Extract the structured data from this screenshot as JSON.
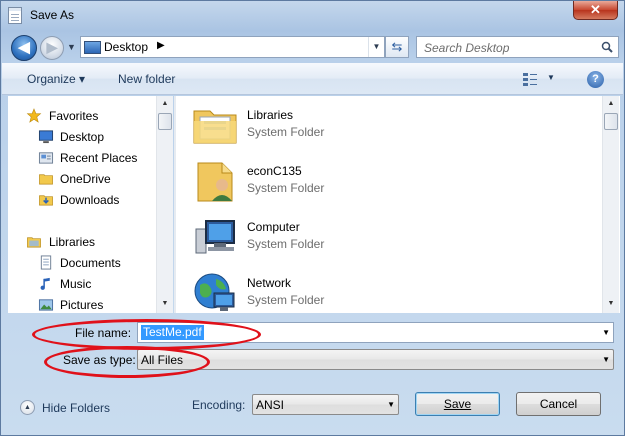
{
  "window": {
    "title": "Save As",
    "close_label": "✕"
  },
  "navbar": {
    "back_label": "◀",
    "forward_label": "▶",
    "address": "Desktop",
    "address_chevron": "▶",
    "search_placeholder": "Search Desktop"
  },
  "toolbar": {
    "organize_label": "Organize ▾",
    "new_folder_label": "New folder",
    "help_label": "?"
  },
  "nav_pane": {
    "items": [
      {
        "label": "Favorites",
        "icon": "star-icon"
      },
      {
        "label": "Desktop",
        "icon": "desktop-icon"
      },
      {
        "label": "Recent Places",
        "icon": "recent-places-icon"
      },
      {
        "label": "OneDrive",
        "icon": "folder-icon"
      },
      {
        "label": "Downloads",
        "icon": "downloads-icon"
      },
      {
        "label": "Libraries",
        "icon": "libraries-icon"
      },
      {
        "label": "Documents",
        "icon": "documents-icon"
      },
      {
        "label": "Music",
        "icon": "music-icon"
      },
      {
        "label": "Pictures",
        "icon": "pictures-icon"
      }
    ]
  },
  "files": [
    {
      "name": "Libraries",
      "type": "System Folder",
      "icon": "libraries-folder-icon"
    },
    {
      "name": "econC135",
      "type": "System Folder",
      "icon": "user-folder-icon"
    },
    {
      "name": "Computer",
      "type": "System Folder",
      "icon": "computer-icon"
    },
    {
      "name": "Network",
      "type": "System Folder",
      "icon": "network-icon"
    }
  ],
  "form": {
    "file_name_label": "File name:",
    "file_name_value": "TestMe.pdf",
    "save_type_label": "Save as type:",
    "save_type_value": "All Files",
    "hide_folders_label": "Hide Folders",
    "encoding_label": "Encoding:",
    "encoding_value": "ANSI",
    "save_label": "Save",
    "cancel_label": "Cancel"
  },
  "annotations": {
    "color": "#e0111a"
  }
}
